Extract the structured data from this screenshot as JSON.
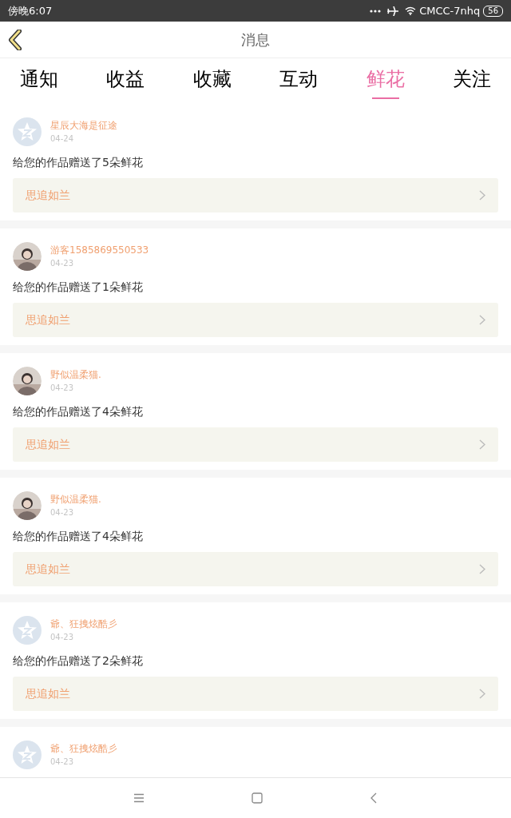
{
  "status_bar": {
    "time": "傍晚6:07",
    "carrier": "CMCC-7nhq",
    "battery": "56"
  },
  "header": {
    "title": "消息"
  },
  "tabs": [
    {
      "label": "通知",
      "selected": false
    },
    {
      "label": "收益",
      "selected": false
    },
    {
      "label": "收藏",
      "selected": false
    },
    {
      "label": "互动",
      "selected": false
    },
    {
      "label": "鲜花",
      "selected": true
    },
    {
      "label": "关注",
      "selected": false
    }
  ],
  "messages": [
    {
      "avatar": {
        "kind": "default"
      },
      "name": "星辰大海是征途",
      "date": "04-24",
      "text": "给您的作品赠送了5朵鲜花",
      "work": "思追如兰"
    },
    {
      "name": "游客1585869550533",
      "date": "04-23",
      "text": "给您的作品赠送了1朵鲜花",
      "work": "思追如兰"
    },
    {
      "name": "野似温柔猫.",
      "date": "04-23",
      "text": "给您的作品赠送了4朵鲜花",
      "work": "思追如兰"
    },
    {
      "name": "野似温柔猫.",
      "date": "04-23",
      "text": "给您的作品赠送了4朵鲜花",
      "work": "思追如兰"
    },
    {
      "avatar": {
        "kind": "default"
      },
      "name": "爺、狂拽炫酷彡",
      "date": "04-23",
      "text": "给您的作品赠送了2朵鲜花",
      "work": "思追如兰"
    },
    {
      "avatar": {
        "kind": "default"
      },
      "name": "爺、狂拽炫酷彡",
      "date": "04-23"
    }
  ]
}
